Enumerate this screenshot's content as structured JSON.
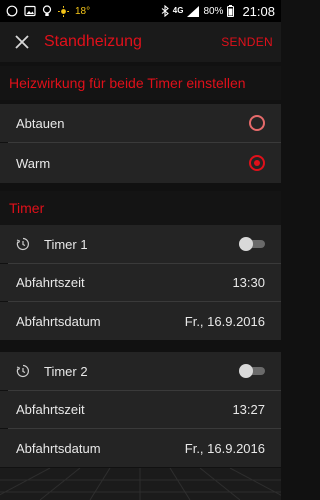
{
  "status_bar": {
    "temperature": "18°",
    "network": "4G",
    "battery_pct": "80%",
    "time": "21:08"
  },
  "header": {
    "title": "Standheizung",
    "send_label": "SENDEN"
  },
  "heat_section": {
    "title": "Heizwirkung für beide Timer einstellen",
    "options": [
      {
        "label": "Abtauen",
        "selected": false
      },
      {
        "label": "Warm",
        "selected": true
      }
    ]
  },
  "timer_section": {
    "title": "Timer",
    "timers": [
      {
        "name": "Timer 1",
        "enabled": false,
        "departure_time_label": "Abfahrtszeit",
        "departure_time": "13:30",
        "departure_date_label": "Abfahrtsdatum",
        "departure_date": "Fr., 16.9.2016"
      },
      {
        "name": "Timer 2",
        "enabled": false,
        "departure_time_label": "Abfahrtszeit",
        "departure_time": "13:27",
        "departure_date_label": "Abfahrtsdatum",
        "departure_date": "Fr., 16.9.2016"
      }
    ]
  },
  "colors": {
    "accent": "#e0101a",
    "background": "#111111",
    "row_background": "#242424"
  }
}
